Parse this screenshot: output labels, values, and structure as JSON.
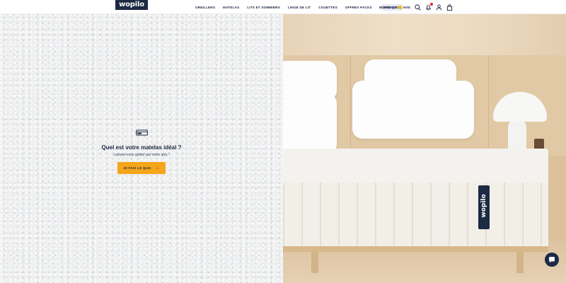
{
  "header": {
    "logo": "wopilo",
    "nav": [
      "OREILLERS",
      "MATELAS",
      "LITS ET SOMMIERS",
      "LINGE DE LIT",
      "COUETTES",
      "OFFRES PACKS"
    ],
    "nav_pill": "NOS QUIZ",
    "wopidays": "WOPIDAYS",
    "reviews": "AVIS",
    "icons": [
      "search-icon",
      "bell-icon",
      "user-icon",
      "bag-icon"
    ],
    "notification_color": "#e22233"
  },
  "quiz": {
    "title": "Quel est votre matelas idéal ?",
    "subtitle": "Laissez-vous guider par notre quiz !",
    "button": "JE FAIS LE QUIZ",
    "button_color": "#f6a61b"
  },
  "hero": {
    "brand_tag": "wopilo"
  },
  "colors": {
    "navy": "#1d2a44",
    "accent": "#f6a61b"
  }
}
